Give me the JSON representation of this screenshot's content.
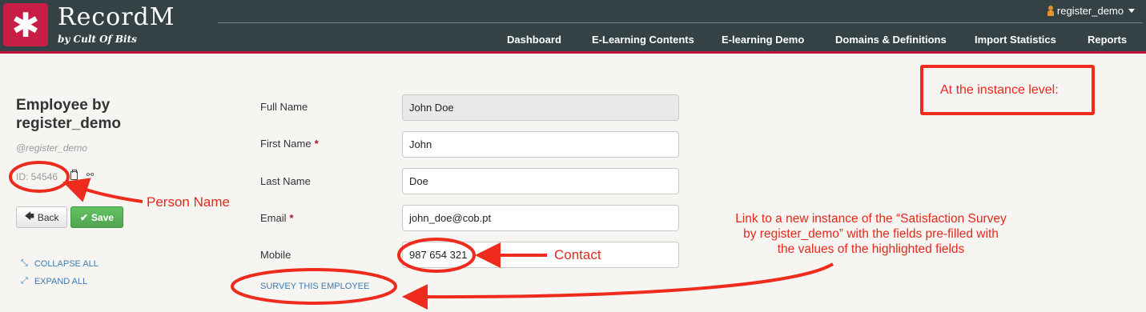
{
  "header": {
    "logo_glyph": "✱",
    "app_title": "RecordM",
    "app_subtitle": "by Cult Of Bits",
    "user": "register_demo",
    "nav": [
      "Dashboard",
      "E-Learning Contents",
      "E-learning Demo",
      "Domains & Definitions",
      "Import Statistics",
      "Reports"
    ]
  },
  "sidebar": {
    "title": "Employee by register_demo",
    "username": "@register_demo",
    "id_label": "ID: 54546",
    "back_label": "Back",
    "save_label": "Save",
    "collapse_label": "COLLAPSE ALL",
    "expand_label": "EXPAND ALL"
  },
  "form": {
    "fields": [
      {
        "label": "Full Name",
        "value": "John Doe",
        "required": false,
        "readonly": true
      },
      {
        "label": "First Name",
        "value": "John",
        "required": true,
        "readonly": false
      },
      {
        "label": "Last Name",
        "value": "Doe",
        "required": false,
        "readonly": false
      },
      {
        "label": "Email",
        "value": "john_doe@cob.pt",
        "required": true,
        "readonly": false
      },
      {
        "label": "Mobile",
        "value": "987 654 321",
        "required": false,
        "readonly": false
      }
    ],
    "required_marker": "*",
    "survey_link": "SURVEY THIS EMPLOYEE"
  },
  "annotations": {
    "instance_level": "At the instance level:",
    "person_name": "Person Name",
    "contact": "Contact",
    "link_note_1": "Link to a new instance of the “Satisfaction Survey",
    "link_note_2": "by register_demo” with the fields pre-filled with",
    "link_note_3": "the values of the highlighted fields"
  },
  "colors": {
    "header_bg": "#344245",
    "accent": "#c81e46",
    "annotation": "#ee2b1c",
    "link": "#3d7bb0",
    "save_green": "#5bb75b"
  }
}
